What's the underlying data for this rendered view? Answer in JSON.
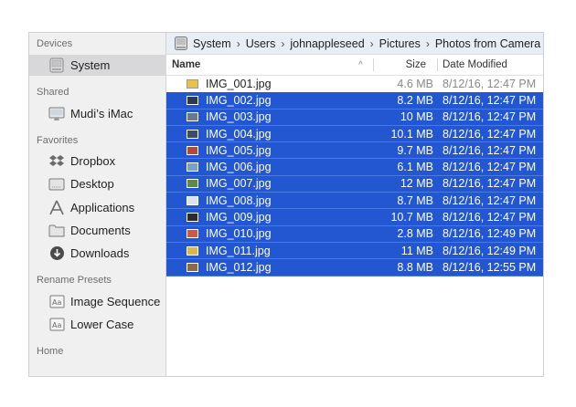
{
  "sidebar": {
    "sections": [
      {
        "header": "Devices",
        "items": [
          {
            "label": "System",
            "icon": "hard-drive-icon",
            "selected": true
          }
        ]
      },
      {
        "header": "Shared",
        "items": [
          {
            "label": "Mudi’s iMac",
            "icon": "imac-icon",
            "selected": false
          }
        ]
      },
      {
        "header": "Favorites",
        "items": [
          {
            "label": "Dropbox",
            "icon": "dropbox-icon",
            "selected": false
          },
          {
            "label": "Desktop",
            "icon": "desktop-folder-icon",
            "selected": false
          },
          {
            "label": "Applications",
            "icon": "applications-icon",
            "selected": false
          },
          {
            "label": "Documents",
            "icon": "folder-icon",
            "selected": false
          },
          {
            "label": "Downloads",
            "icon": "downloads-icon",
            "selected": false
          }
        ]
      },
      {
        "header": "Rename Presets",
        "items": [
          {
            "label": "Image Sequence",
            "icon": "rename-preset-icon",
            "selected": false
          },
          {
            "label": "Lower Case",
            "icon": "rename-preset-icon",
            "selected": false
          }
        ]
      },
      {
        "header": "Home",
        "items": []
      }
    ]
  },
  "path": {
    "icon": "hard-drive-icon",
    "crumbs": [
      "System",
      "Users",
      "johnappleseed",
      "Pictures",
      "Photos from Camera"
    ],
    "separator": "›"
  },
  "columns": {
    "name": "Name",
    "size": "Size",
    "date": "Date Modified",
    "sort_indicator": "^"
  },
  "files": [
    {
      "name": "IMG_001.jpg",
      "size": "4.6 MB",
      "date": "8/12/16, 12:47 PM",
      "selected": false,
      "thumb": "#e8c34a"
    },
    {
      "name": "IMG_002.jpg",
      "size": "8.2 MB",
      "date": "8/12/16, 12:47 PM",
      "selected": true,
      "thumb": "#2a3a55"
    },
    {
      "name": "IMG_003.jpg",
      "size": "10 MB",
      "date": "8/12/16, 12:47 PM",
      "selected": true,
      "thumb": "#6a7a8c"
    },
    {
      "name": "IMG_004.jpg",
      "size": "10.1 MB",
      "date": "8/12/16, 12:47 PM",
      "selected": true,
      "thumb": "#3c4c66"
    },
    {
      "name": "IMG_005.jpg",
      "size": "9.7 MB",
      "date": "8/12/16, 12:47 PM",
      "selected": true,
      "thumb": "#b04a3a"
    },
    {
      "name": "IMG_006.jpg",
      "size": "6.1 MB",
      "date": "8/12/16, 12:47 PM",
      "selected": true,
      "thumb": "#7aa0c8"
    },
    {
      "name": "IMG_007.jpg",
      "size": "12 MB",
      "date": "8/12/16, 12:47 PM",
      "selected": true,
      "thumb": "#5c8a4a"
    },
    {
      "name": "IMG_008.jpg",
      "size": "8.7 MB",
      "date": "8/12/16, 12:47 PM",
      "selected": true,
      "thumb": "#dbe3ee"
    },
    {
      "name": "IMG_009.jpg",
      "size": "10.7 MB",
      "date": "8/12/16, 12:47 PM",
      "selected": true,
      "thumb": "#2c2c2c"
    },
    {
      "name": "IMG_010.jpg",
      "size": "2.8 MB",
      "date": "8/12/16, 12:49 PM",
      "selected": true,
      "thumb": "#c85a4a"
    },
    {
      "name": "IMG_011.jpg",
      "size": "11 MB",
      "date": "8/12/16, 12:49 PM",
      "selected": true,
      "thumb": "#d8b84a"
    },
    {
      "name": "IMG_012.jpg",
      "size": "8.8 MB",
      "date": "8/12/16, 12:55 PM",
      "selected": true,
      "thumb": "#8a6a4a"
    }
  ],
  "colors": {
    "selection": "#2357d1",
    "sidebar_bg": "#f0f0f1",
    "path_bg": "#e8eef5"
  }
}
